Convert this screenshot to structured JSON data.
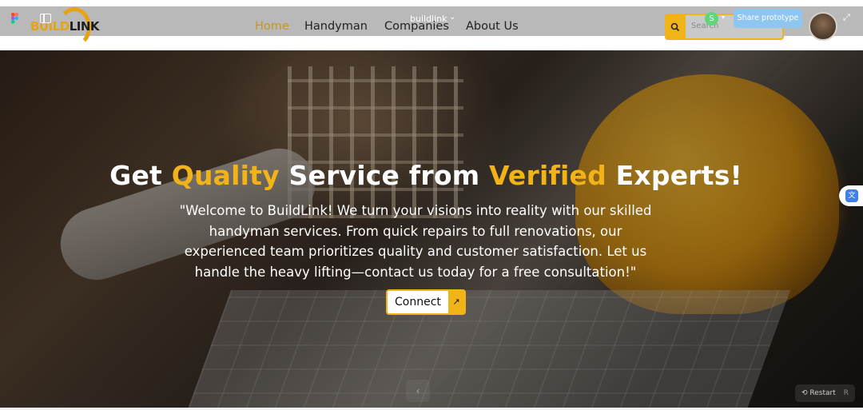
{
  "brand": {
    "logo_part1": "BUILD",
    "logo_part2": "LINK",
    "accent_color": "#f0b419"
  },
  "nav": {
    "items": [
      {
        "label": "Home",
        "active": true
      },
      {
        "label": "Handyman",
        "active": false
      },
      {
        "label": "Companies",
        "active": false
      },
      {
        "label": "About Us",
        "active": false
      }
    ]
  },
  "search": {
    "placeholder": "Search",
    "icon": "search-icon"
  },
  "prototype_bar": {
    "file_name": "buildlink",
    "user_initial": "S",
    "share_label": "Share prototype",
    "share_color": "#8ec6f2"
  },
  "hero": {
    "headline_part1": "Get ",
    "headline_highlight1": "Quality",
    "headline_part2": " Service from ",
    "headline_highlight2": "Verified",
    "headline_part3": " Experts!",
    "paragraph": "\"Welcome to BuildLink! We turn your visions into reality with our skilled handyman services. From quick repairs to full renovations, our experienced team prioritizes quality and customer satisfaction. Let us handle the heavy lifting—contact us today for a free consultation!\"",
    "cta_label": "Connect"
  },
  "controls": {
    "restart_label": "Restart",
    "restart_key": "R"
  }
}
